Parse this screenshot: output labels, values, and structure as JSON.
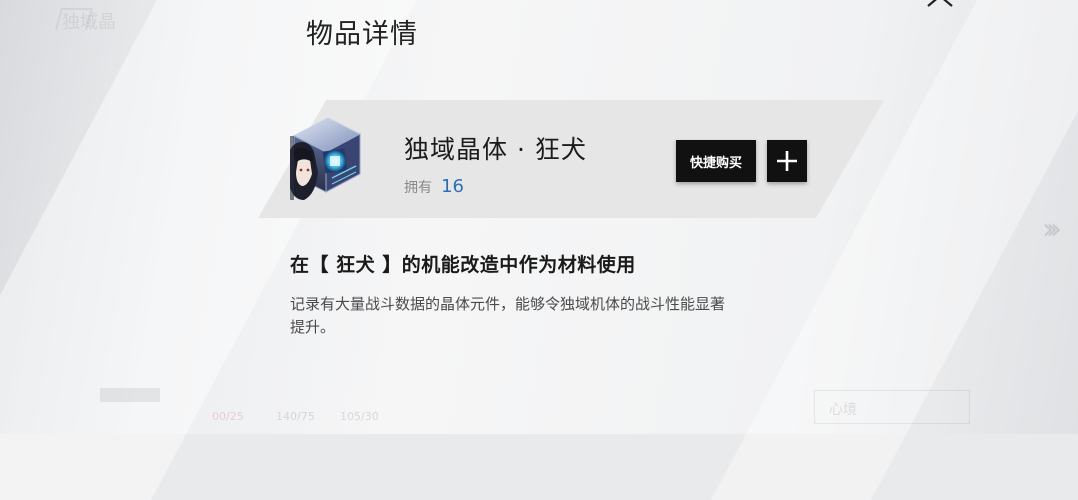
{
  "background": {
    "ghost_title": "独域晶",
    "ghost_stats": [
      {
        "text": "00/25",
        "color": "red"
      },
      {
        "text": "140/75",
        "color": "grey"
      },
      {
        "text": "105/30",
        "color": "grey"
      }
    ],
    "ghost_button": "心境"
  },
  "dialog": {
    "title": "物品详情",
    "close_icon": "close-icon"
  },
  "item": {
    "name": "独域晶体 · 狂犬",
    "owned_label": "拥有",
    "owned_count": "16",
    "icon": "crystal-item-icon",
    "quick_buy_label": "快捷购买",
    "add_icon": "plus-icon",
    "usage": "在【 狂犬 】的机能改造中作为材料使用",
    "description": "记录有大量战斗数据的晶体元件，能够令独域机体的战斗性能显著提升。"
  },
  "colors": {
    "accent_blue": "#2c6fb6",
    "button_bg": "#111111"
  }
}
